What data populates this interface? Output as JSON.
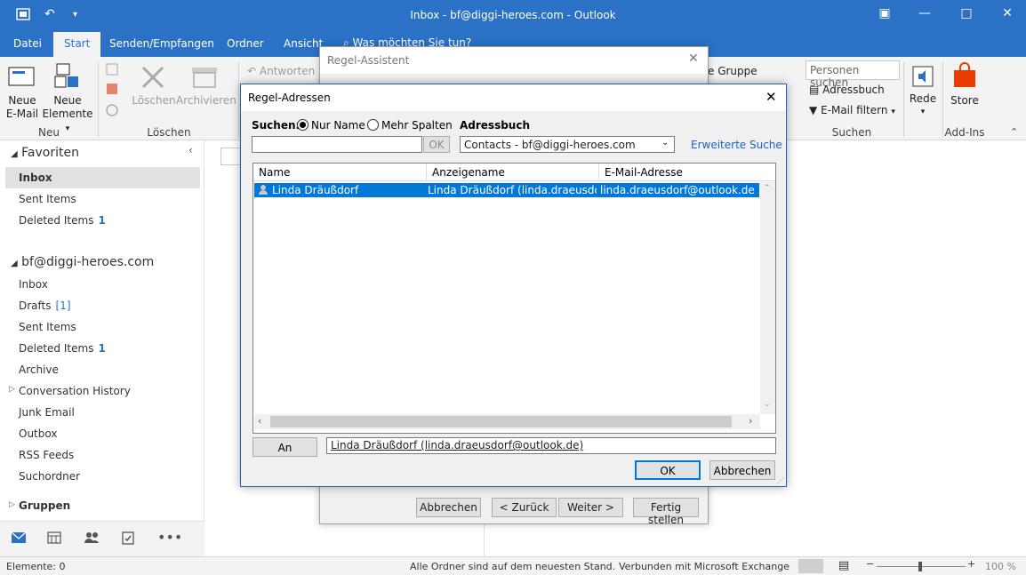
{
  "window": {
    "title": "Inbox - bf@diggi-heroes.com  -  Outlook"
  },
  "tabs": [
    "Datei",
    "Start",
    "Senden/Empfangen",
    "Ordner",
    "Ansicht"
  ],
  "tell_me": "Was möchten Sie tun?",
  "ribbon": {
    "new_email": [
      "Neue",
      "E-Mail"
    ],
    "new_items": [
      "Neue",
      "Elemente"
    ],
    "delete": "Löschen",
    "archive": "Archivieren",
    "group_new": "Neu",
    "group_delete": "Löschen",
    "reply": "Antworten",
    "new_group": "e Gruppe",
    "search_people_placeholder": "Personen suchen",
    "address_book": "Adressbuch",
    "filter_email": "E-Mail filtern",
    "group_search": "Suchen",
    "speech": "Rede",
    "store": "Store",
    "group_addins": "Add-Ins"
  },
  "nav": {
    "favorites_header": "Favoriten",
    "favorites": [
      {
        "label": "Inbox"
      },
      {
        "label": "Sent Items"
      },
      {
        "label": "Deleted Items",
        "count": "1"
      }
    ],
    "account": "bf@diggi-heroes.com",
    "folders": [
      {
        "label": "Inbox"
      },
      {
        "label": "Drafts",
        "count": "[1]"
      },
      {
        "label": "Sent Items"
      },
      {
        "label": "Deleted Items",
        "count": "1"
      },
      {
        "label": "Archive"
      },
      {
        "label": "Conversation History"
      },
      {
        "label": "Junk Email"
      },
      {
        "label": "Outbox"
      },
      {
        "label": "RSS Feeds"
      },
      {
        "label": "Suchordner"
      }
    ],
    "groups": "Gruppen"
  },
  "status": {
    "items": "Elemente: 0",
    "sync": "Alle Ordner sind auf dem neuesten Stand.",
    "connection": "Verbunden mit Microsoft Exchange",
    "zoom": "100 %"
  },
  "assistant": {
    "title": "Regel-Assistent",
    "cancel": "Abbrechen",
    "back": "< Zurück",
    "next": "Weiter >",
    "finish": "Fertig stellen"
  },
  "dialog": {
    "title": "Regel-Adressen",
    "search_label": "Suchen:",
    "opt_name_only": "Nur Name",
    "opt_more_columns": "Mehr Spalten",
    "address_book_label": "Adressbuch",
    "ok_small": "OK",
    "address_book_value": "Contacts - bf@diggi-heroes.com",
    "advanced_search": "Erweiterte Suche",
    "columns": [
      "Name",
      "Anzeigename",
      "E-Mail-Adresse"
    ],
    "rows": [
      {
        "name": "Linda Dräußdorf",
        "display": "Linda Dräußdorf (linda.draeusdorf...",
        "email": "linda.draeusdorf@outlook.de"
      }
    ],
    "to_button": "An",
    "to_value": "Linda Dräußdorf (linda.draeusdorf@outlook.de)",
    "ok": "OK",
    "cancel": "Abbrechen"
  }
}
